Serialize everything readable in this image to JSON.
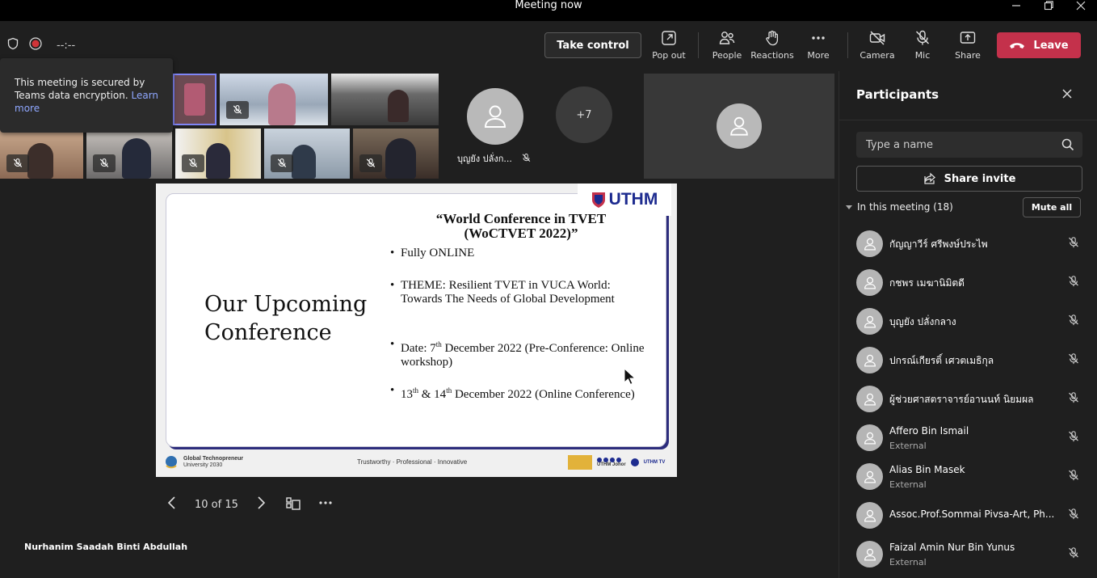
{
  "window": {
    "title": "Meeting now",
    "minimize_icon": "minimize-icon",
    "maximize_icon": "maximize-icon",
    "close_icon": "close-icon"
  },
  "toolbar": {
    "timer": "--:--",
    "take_control": "Take control",
    "buttons": {
      "popout": "Pop out",
      "people": "People",
      "reactions": "Reactions",
      "more": "More",
      "camera": "Camera",
      "mic": "Mic",
      "share": "Share"
    },
    "leave": "Leave",
    "colors": {
      "leave": "#c4314b",
      "active": "#7f85f5"
    }
  },
  "security_tip": {
    "text": "This meeting is secured by Teams data encryption.",
    "link": "Learn more"
  },
  "video_grid": {
    "participant_name": "บุญยัง ปลั่งก...",
    "more_count": "+7"
  },
  "slide": {
    "left_title_line1": "Our Upcoming",
    "left_title_line2": "Conference",
    "conference_title_line1": "“World Conference in TVET",
    "conference_title_line2": "(WoCTVET 2022)”",
    "bullets": {
      "b1": "Fully ONLINE",
      "b2": "THEME: Resilient TVET in VUCA World: Towards The Needs of Global Development",
      "b3_pre": "Date: 7",
      "b3_sup": "th",
      "b3_post": " December 2022 (Pre-Conference: Online workshop)",
      "b4_pre": "13",
      "b4_sup1": "th",
      "b4_mid": " & 14",
      "b4_sup2": "th",
      "b4_post": " December 2022 (Online Conference)"
    },
    "logo_text": "UTHM",
    "footer_left_1": "Global Technopreneur",
    "footer_left_2": "University 2030",
    "footer_mid": "Trustworthy · Professional · Innovative",
    "footer_right_1": "UTHM Johor",
    "footer_right_2": "UTHM TV"
  },
  "slide_nav": {
    "counter": "10 of 15"
  },
  "presenter": "Nurhanim Saadah Binti Abdullah",
  "panel": {
    "title": "Participants",
    "search_placeholder": "Type a name",
    "share_invite": "Share invite",
    "section": "In this meeting (18)",
    "mute_all": "Mute all",
    "participants": [
      {
        "name": "กัญญาวีร์ ศรีพงษ์ประไพ",
        "sub": ""
      },
      {
        "name": "กชพร เมฆานิมิตดี",
        "sub": ""
      },
      {
        "name": "บุญยัง ปลั่งกลาง",
        "sub": ""
      },
      {
        "name": "ปกรณ์เกียรติ์ เศวตเมธิกุล",
        "sub": ""
      },
      {
        "name": "ผู้ช่วยศาสตราจารย์อานนท์ นิยมผล",
        "sub": ""
      },
      {
        "name": "Affero Bin Ismail",
        "sub": "External"
      },
      {
        "name": "Alias Bin Masek",
        "sub": "External"
      },
      {
        "name": "Assoc.Prof.Sommai Pivsa-Art, Ph...",
        "sub": ""
      },
      {
        "name": "Faizal Amin Nur Bin Yunus",
        "sub": "External"
      }
    ]
  }
}
